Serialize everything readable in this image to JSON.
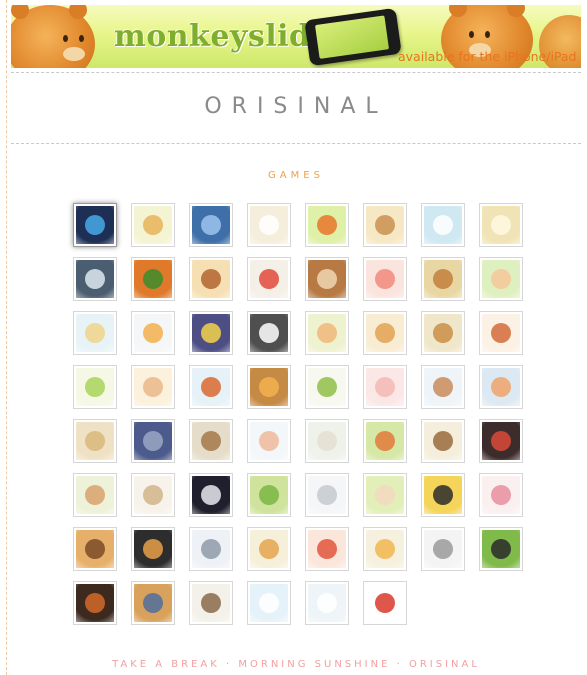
{
  "banner": {
    "logo_text": "monkeyslide",
    "availability_text": "available for the iPhone/iPad"
  },
  "site": {
    "title": "ORISINAL"
  },
  "games_section": {
    "title": "GAMES"
  },
  "footer": {
    "text": "TAKE A BREAK · MORNING SUNSHINE · ORISINAL"
  },
  "games": [
    {
      "icon": "bluebird-icon",
      "bg": "#1e2f55",
      "fg": "#47a9e8",
      "featured": true
    },
    {
      "icon": "giraffe-icon",
      "bg": "#f4f3d2",
      "fg": "#e6b35a"
    },
    {
      "icon": "blue-chair-icon",
      "bg": "#3f6fa8",
      "fg": "#9dc4ee"
    },
    {
      "icon": "chicken-icon",
      "bg": "#f6eedc",
      "fg": "#ffffff"
    },
    {
      "icon": "carrot-icon",
      "bg": "#dff0a8",
      "fg": "#e9762a"
    },
    {
      "icon": "cottage-icon",
      "bg": "#f7e8c5",
      "fg": "#c9914f"
    },
    {
      "icon": "sun-icon",
      "bg": "#cfe8f2",
      "fg": "#ffffff"
    },
    {
      "icon": "forest-light-icon",
      "bg": "#f0e3b5",
      "fg": "#fff9e0"
    },
    {
      "icon": "bell-icon",
      "bg": "#4b5d71",
      "fg": "#dfe7ef"
    },
    {
      "icon": "clover-ball-icon",
      "bg": "#e07a2a",
      "fg": "#3b8d2b"
    },
    {
      "icon": "puppy-icon",
      "bg": "#f6dfb3",
      "fg": "#b2652e"
    },
    {
      "icon": "window-apple-icon",
      "bg": "#f4efe7",
      "fg": "#e14a3a"
    },
    {
      "icon": "teapot-icon",
      "bg": "#b77a45",
      "fg": "#efd7b0"
    },
    {
      "icon": "pink-flower-icon",
      "bg": "#fbe4de",
      "fg": "#f08a7a"
    },
    {
      "icon": "monkey-icon",
      "bg": "#e9d7a3",
      "fg": "#c2803c"
    },
    {
      "icon": "hamster-leaf-icon",
      "bg": "#dff0c0",
      "fg": "#f4c79a"
    },
    {
      "icon": "bee-icon",
      "bg": "#e8f3f8",
      "fg": "#efd48a"
    },
    {
      "icon": "swan-icon",
      "bg": "#f5f6f7",
      "fg": "#f2b04e"
    },
    {
      "icon": "star-icon",
      "bg": "#4d4f84",
      "fg": "#f3d34b"
    },
    {
      "icon": "cats-icon",
      "bg": "#4f4f4f",
      "fg": "#ffffff"
    },
    {
      "icon": "bird-hill-icon",
      "bg": "#eef2cf",
      "fg": "#f0b97a"
    },
    {
      "icon": "teddy-bear-icon",
      "bg": "#f8ecd2",
      "fg": "#e3a253"
    },
    {
      "icon": "scarecrow-icon",
      "bg": "#f0e6c9",
      "fg": "#c98e46"
    },
    {
      "icon": "boy-icon",
      "bg": "#fbf1e4",
      "fg": "#d36b3a"
    },
    {
      "icon": "tree-icon",
      "bg": "#f4f8e4",
      "fg": "#a7d35a"
    },
    {
      "icon": "chick-icon",
      "bg": "#fbf1dc",
      "fg": "#e9b98a"
    },
    {
      "icon": "boat-icon",
      "bg": "#e6f1f8",
      "fg": "#d9692f"
    },
    {
      "icon": "nest-bird-icon",
      "bg": "#c58a44",
      "fg": "#f2b04e"
    },
    {
      "icon": "panda-face-icon",
      "bg": "#f7f8ef",
      "fg": "#8fbf4a"
    },
    {
      "icon": "pig-icon",
      "bg": "#fbe8e6",
      "fg": "#f3b8b4"
    },
    {
      "icon": "child-icon",
      "bg": "#eef4f8",
      "fg": "#c98b5a"
    },
    {
      "icon": "sunflower-icon",
      "bg": "#dde9f2",
      "fg": "#f0a36b"
    },
    {
      "icon": "hedgehog-icon",
      "bg": "#efe2c4",
      "fg": "#d8b77b"
    },
    {
      "icon": "robot-bear-icon",
      "bg": "#4c5b8c",
      "fg": "#9aa7c4"
    },
    {
      "icon": "brown-bear-icon",
      "bg": "#e5ddc9",
      "fg": "#a4784a"
    },
    {
      "icon": "kite-icon",
      "bg": "#f3f7f9",
      "fg": "#efb89c"
    },
    {
      "icon": "mouse-icon",
      "bg": "#eef2ea",
      "fg": "#e4e0d0"
    },
    {
      "icon": "dragonfly-icon",
      "bg": "#d6e8a6",
      "fg": "#e37a3a"
    },
    {
      "icon": "raccoon-icon",
      "bg": "#f5eedc",
      "fg": "#9a6b3c"
    },
    {
      "icon": "jewel-blocks-icon",
      "bg": "#3d2c2c",
      "fg": "#d94a3a"
    },
    {
      "icon": "egg-icon",
      "bg": "#eef2d8",
      "fg": "#d8a26e"
    },
    {
      "icon": "sailboat-icon",
      "bg": "#f7f3ea",
      "fg": "#d1b38a"
    },
    {
      "icon": "moon-icon",
      "bg": "#1f1f2e",
      "fg": "#e9e9f0"
    },
    {
      "icon": "frog-icon",
      "bg": "#cfe39c",
      "fg": "#7ab644"
    },
    {
      "icon": "koala-icon",
      "bg": "#f4f6f8",
      "fg": "#c6c9cf"
    },
    {
      "icon": "sheep-icon",
      "bg": "#e2efb8",
      "fg": "#f3d8c0"
    },
    {
      "icon": "bumblebee-icon",
      "bg": "#f5d45a",
      "fg": "#2b2b2b"
    },
    {
      "icon": "girl-icon",
      "bg": "#fbf0f0",
      "fg": "#e78ea0"
    },
    {
      "icon": "cowboy-icon",
      "bg": "#e7b06a",
      "fg": "#7a4b26"
    },
    {
      "icon": "reindeer-icon",
      "bg": "#2d2d2d",
      "fg": "#e8a04a"
    },
    {
      "icon": "ufo-icon",
      "bg": "#eef2f6",
      "fg": "#8f9ba9"
    },
    {
      "icon": "start-booth-icon",
      "bg": "#f6efd9",
      "fg": "#e5a44e"
    },
    {
      "icon": "crab-icon",
      "bg": "#fbe6dc",
      "fg": "#e0553d"
    },
    {
      "icon": "balloon-icon",
      "bg": "#f6f1de",
      "fg": "#f1b64f"
    },
    {
      "icon": "cow-grey-icon",
      "bg": "#f4f4f4",
      "fg": "#9a9a9a"
    },
    {
      "icon": "cow-field-icon",
      "bg": "#7fba4a",
      "fg": "#2a2a2a"
    },
    {
      "icon": "orange-ball-icon",
      "bg": "#3d2a1f",
      "fg": "#d46a2a"
    },
    {
      "icon": "robot-icon",
      "bg": "#d9a25c",
      "fg": "#4f6e9a"
    },
    {
      "icon": "cannon-man-icon",
      "bg": "#f4f1ea",
      "fg": "#8a6a4a"
    },
    {
      "icon": "sky-icon",
      "bg": "#e6f2f9",
      "fg": "#ffffff"
    },
    {
      "icon": "snowman-icon",
      "bg": "#eef4f8",
      "fg": "#ffffff"
    },
    {
      "icon": "apple-icon",
      "bg": "#ffffff",
      "fg": "#d93a2a"
    }
  ]
}
